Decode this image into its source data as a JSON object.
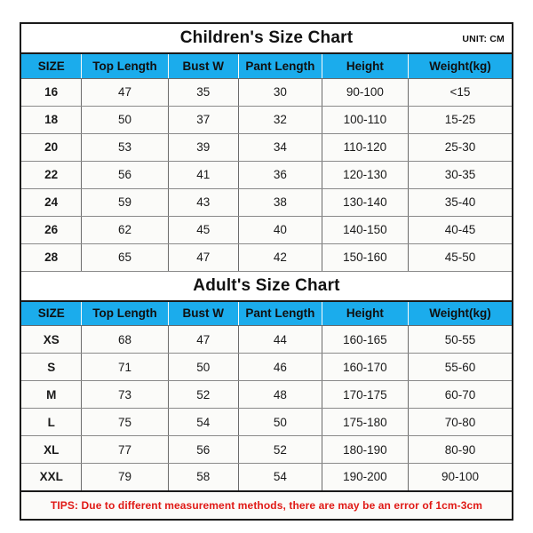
{
  "document": {
    "page_background": "#ffffff",
    "accent_color": "#1BACEC",
    "tips_color": "#e01a16",
    "border_color": "#1a1a1a"
  },
  "children_section": {
    "title": "Children's Size Chart",
    "unit_label": "UNIT: CM",
    "columns": [
      "SIZE",
      "Top Length",
      "Bust W",
      "Pant Length",
      "Height",
      "Weight(kg)"
    ],
    "rows": [
      [
        "16",
        "47",
        "35",
        "30",
        "90-100",
        "<15"
      ],
      [
        "18",
        "50",
        "37",
        "32",
        "100-110",
        "15-25"
      ],
      [
        "20",
        "53",
        "39",
        "34",
        "110-120",
        "25-30"
      ],
      [
        "22",
        "56",
        "41",
        "36",
        "120-130",
        "30-35"
      ],
      [
        "24",
        "59",
        "43",
        "38",
        "130-140",
        "35-40"
      ],
      [
        "26",
        "62",
        "45",
        "40",
        "140-150",
        "40-45"
      ],
      [
        "28",
        "65",
        "47",
        "42",
        "150-160",
        "45-50"
      ]
    ]
  },
  "adult_section": {
    "title": "Adult's Size Chart",
    "columns": [
      "SIZE",
      "Top Length",
      "Bust W",
      "Pant Length",
      "Height",
      "Weight(kg)"
    ],
    "rows": [
      [
        "XS",
        "68",
        "47",
        "44",
        "160-165",
        "50-55"
      ],
      [
        "S",
        "71",
        "50",
        "46",
        "160-170",
        "55-60"
      ],
      [
        "M",
        "73",
        "52",
        "48",
        "170-175",
        "60-70"
      ],
      [
        "L",
        "75",
        "54",
        "50",
        "175-180",
        "70-80"
      ],
      [
        "XL",
        "77",
        "56",
        "52",
        "180-190",
        "80-90"
      ],
      [
        "XXL",
        "79",
        "58",
        "54",
        "190-200",
        "90-100"
      ]
    ]
  },
  "footer": {
    "tips": "TIPS: Due to different measurement methods, there are may be an error of 1cm-3cm"
  },
  "chart_data": {
    "type": "table",
    "title": "Children's and Adult's Size Chart",
    "unit": "CM",
    "tables": [
      {
        "name": "Children's Size Chart",
        "columns": [
          "SIZE",
          "Top Length",
          "Bust W",
          "Pant Length",
          "Height",
          "Weight(kg)"
        ],
        "rows": [
          [
            "16",
            "47",
            "35",
            "30",
            "90-100",
            "<15"
          ],
          [
            "18",
            "50",
            "37",
            "32",
            "100-110",
            "15-25"
          ],
          [
            "20",
            "53",
            "39",
            "34",
            "110-120",
            "25-30"
          ],
          [
            "22",
            "56",
            "41",
            "36",
            "120-130",
            "30-35"
          ],
          [
            "24",
            "59",
            "43",
            "38",
            "130-140",
            "35-40"
          ],
          [
            "26",
            "62",
            "45",
            "40",
            "140-150",
            "40-45"
          ],
          [
            "28",
            "65",
            "47",
            "42",
            "150-160",
            "45-50"
          ]
        ]
      },
      {
        "name": "Adult's Size Chart",
        "columns": [
          "SIZE",
          "Top Length",
          "Bust W",
          "Pant Length",
          "Height",
          "Weight(kg)"
        ],
        "rows": [
          [
            "XS",
            "68",
            "47",
            "44",
            "160-165",
            "50-55"
          ],
          [
            "S",
            "71",
            "50",
            "46",
            "160-170",
            "55-60"
          ],
          [
            "M",
            "73",
            "52",
            "48",
            "170-175",
            "60-70"
          ],
          [
            "L",
            "75",
            "54",
            "50",
            "175-180",
            "70-80"
          ],
          [
            "XL",
            "77",
            "56",
            "52",
            "180-190",
            "80-90"
          ],
          [
            "XXL",
            "79",
            "58",
            "54",
            "190-200",
            "90-100"
          ]
        ]
      }
    ],
    "note": "TIPS: Due to different measurement methods, there are may be an error of 1cm-3cm"
  }
}
